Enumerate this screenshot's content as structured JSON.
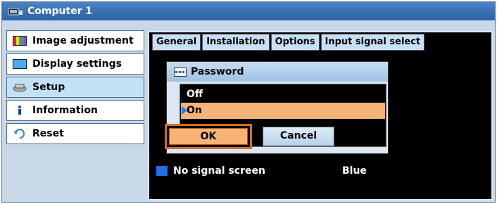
{
  "window": {
    "title": "Computer 1",
    "icon": "projector-computer-icon"
  },
  "sidebar": {
    "items": [
      {
        "label": "Image adjustment",
        "icon": "image-adjustment-icon",
        "active": false
      },
      {
        "label": "Display settings",
        "icon": "display-settings-icon",
        "active": false
      },
      {
        "label": "Setup",
        "icon": "setup-icon",
        "active": true
      },
      {
        "label": "Information",
        "icon": "information-icon",
        "active": false
      },
      {
        "label": "Reset",
        "icon": "reset-icon",
        "active": false
      }
    ]
  },
  "tabs": [
    {
      "label": "General"
    },
    {
      "label": "Installation"
    },
    {
      "label": "Options"
    },
    {
      "label": "Input signal select"
    }
  ],
  "rows": [
    {
      "label": "No signal screen",
      "value": "Blue"
    }
  ],
  "dialog": {
    "title": "Password",
    "options": [
      {
        "label": "Off",
        "selected": false
      },
      {
        "label": "On",
        "selected": true
      }
    ],
    "ok_label": "OK",
    "cancel_label": "Cancel"
  },
  "colors": {
    "title_bar": "#2d62a4",
    "highlight": "#f5b47a",
    "active_sidebar": "#c3e1f6"
  }
}
